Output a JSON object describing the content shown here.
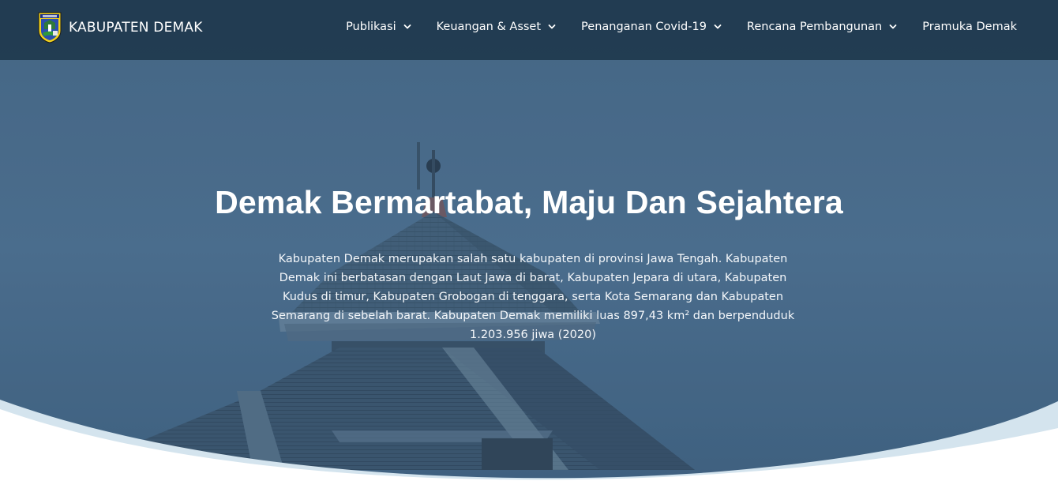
{
  "header": {
    "brand_name": "KABUPATEN DEMAK",
    "logo_icon": "demak-crest-icon",
    "nav": [
      {
        "label": "Publikasi",
        "has_dropdown": true
      },
      {
        "label": "Keuangan & Asset",
        "has_dropdown": true
      },
      {
        "label": "Penanganan Covid-19",
        "has_dropdown": true
      },
      {
        "label": "Rencana Pembangunan",
        "has_dropdown": true
      },
      {
        "label": "Pramuka Demak",
        "has_dropdown": false
      }
    ]
  },
  "hero": {
    "title": "Demak Bermartabat, Maju Dan Sejahtera",
    "description": "Kabupaten Demak merupakan salah satu kabupaten di provinsi Jawa Tengah. Kabupaten Demak ini berbatasan dengan Laut Jawa di barat, Kabupaten Jepara di utara, Kabupaten Kudus di timur, Kabupaten Grobogan di tenggara, serta Kota Semarang dan Kabupaten Semarang di sebelah barat. Kabupaten Demak memiliki luas 897,43 km² dan berpenduduk 1.203.956 jiwa (2020)"
  },
  "colors": {
    "header_bg": "#1e374b",
    "hero_bg": "#4f7190",
    "wave_light": "#d4e4ee",
    "wave_white": "#ffffff"
  }
}
